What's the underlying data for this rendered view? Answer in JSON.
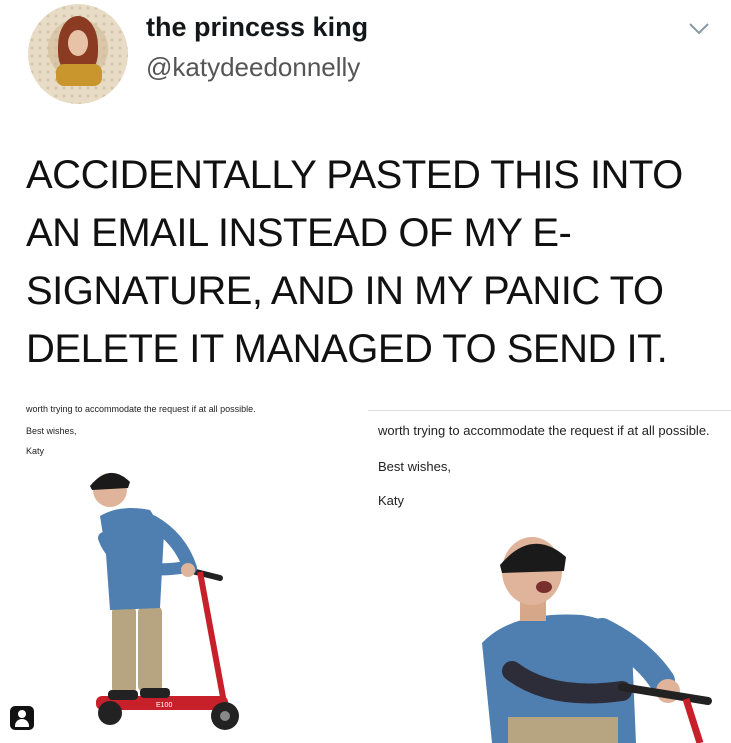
{
  "tweet": {
    "display_name": "the princess king",
    "handle": "@katydeedonnelly",
    "text_lines": [
      "ACCIDENTALLY PASTED THIS INTO",
      "AN EMAIL INSTEAD OF MY E-",
      "SIGNATURE, AND IN MY PANIC TO",
      "DELETE IT MANAGED TO SEND IT."
    ]
  },
  "email_small": {
    "line1": "worth trying to accommodate the request if at all possible.",
    "line2": "Best wishes,",
    "line3": "Katy"
  },
  "email_large": {
    "line1": "worth trying to accommodate the request if at all possible.",
    "line2": "Best wishes,",
    "line3": "Katy"
  },
  "scooter_label": "E100",
  "icons": {
    "menu": "chevron-down-icon",
    "avatar": "avatar",
    "corner": "user-icon"
  }
}
